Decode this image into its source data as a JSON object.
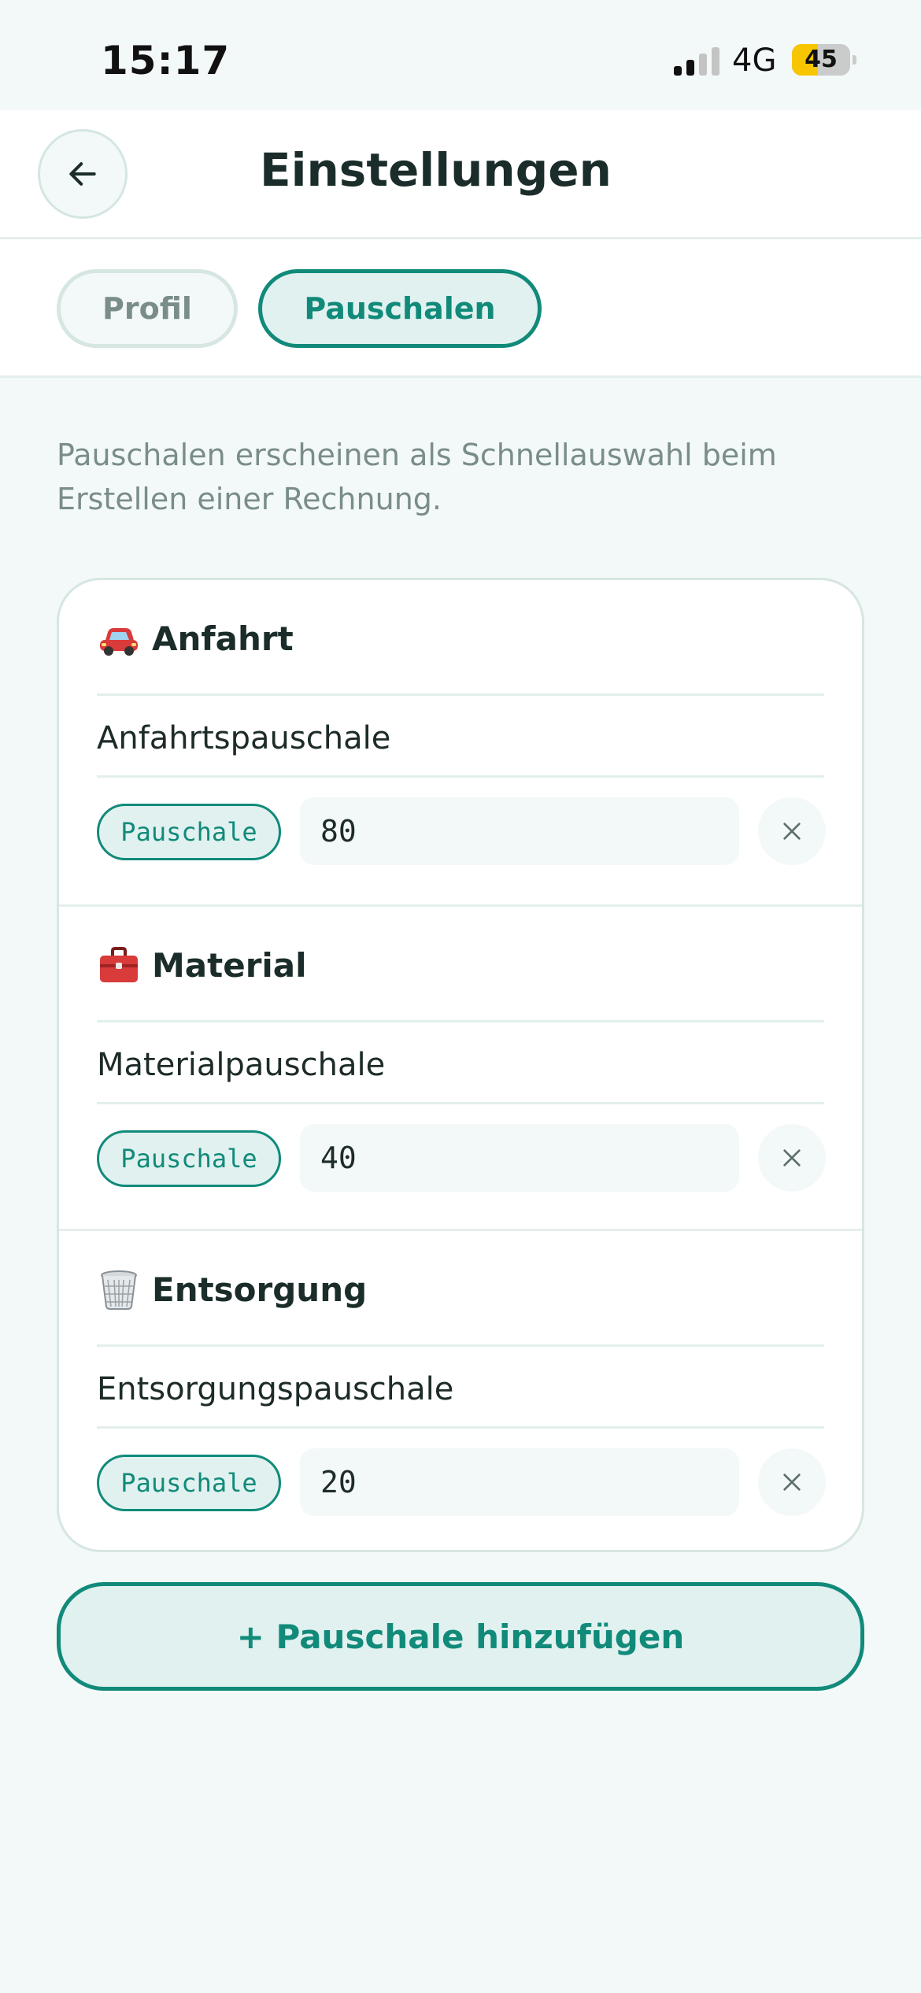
{
  "status_bar": {
    "time": "15:17",
    "network": "4G",
    "battery": "45",
    "battery_level": 0.45
  },
  "header": {
    "title": "Einstellungen",
    "back_icon": "arrow-left-icon"
  },
  "tabs": [
    {
      "label": "Profil",
      "active": false
    },
    {
      "label": "Pauschalen",
      "active": true
    }
  ],
  "intro": "Pauschalen erscheinen als Schnellauswahl beim Erstellen einer Rechnung.",
  "items": [
    {
      "icon": "car-icon",
      "category": "Anfahrt",
      "name": "Anfahrtspauschale",
      "type": "Pauschale",
      "amount": "80"
    },
    {
      "icon": "toolbox-icon",
      "category": "Material",
      "name": "Materialpauschale",
      "type": "Pauschale",
      "amount": "40"
    },
    {
      "icon": "wastebasket-icon",
      "category": "Entsorgung",
      "name": "Entsorgungspauschale",
      "type": "Pauschale",
      "amount": "20"
    }
  ],
  "add_button": "+ Pauschale hinzufügen",
  "colors": {
    "accent": "#118a7a",
    "accent_light": "#e0f1ef",
    "background": "#f3f9f8",
    "muted_text": "#7a8d89"
  }
}
